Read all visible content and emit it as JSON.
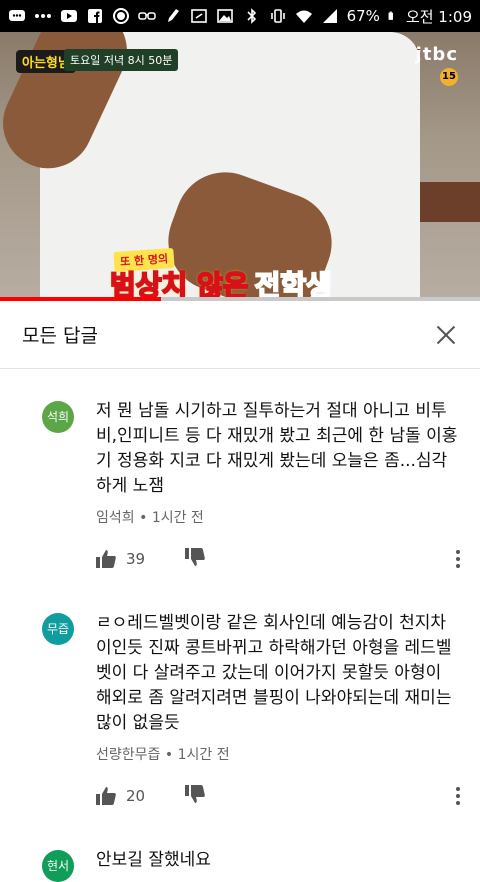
{
  "status_bar": {
    "battery": "67%",
    "time": "오전 1:09",
    "icons": [
      "chat-icon",
      "more-icon",
      "youtube-icon",
      "facebook-icon",
      "record-icon",
      "glasses-icon",
      "clean-icon",
      "screenshot-icon",
      "gallery-icon",
      "bluetooth-icon",
      "vibrate-icon",
      "wifi-icon",
      "signal-icon",
      "battery-icon"
    ]
  },
  "video": {
    "show_logo": "아는형님",
    "airtime": "토요일 저녁 8시 50분",
    "channel": "jtbc",
    "age_rating": "15",
    "caption_small": "또 한 명의",
    "caption_white": "범상치 않은",
    "caption_red": "전학생",
    "progress": 0.335
  },
  "panel": {
    "title": "모든 답글"
  },
  "comments": [
    {
      "avatar_text": "석희",
      "avatar_color": "#5ba747",
      "text": "저 뭔 남돌 시기하고 질투하는거 절대 아니고 비투비,인피니트 등 다 재밌개 봤고 최근에 한 남돌 이홍기 정용화 지코 다 재밌게 봤는데 오늘은 좀...심각하게 노잼",
      "author": "임석희",
      "time": "1시간 전",
      "likes": "39"
    },
    {
      "avatar_text": "무즙",
      "avatar_color": "#0f9d9f",
      "text": "ㄹㅇ레드벨벳이랑  같은 회사인데  예능감이 천지차이인듯 진짜 콩트바뀌고 하락해가던 아형을 레드벨벳이 다 살려주고 갔는데 이어가지 못할듯 아형이 해외로 좀 알려지려면 블핑이 나와야되는데 재미는 많이 없을듯",
      "author": "선량한무즙",
      "time": "1시간 전",
      "likes": "20"
    },
    {
      "avatar_text": "현서",
      "avatar_color": "#0f9d58",
      "text": "안보길 잘했네요",
      "author": "",
      "time": "",
      "likes": ""
    }
  ]
}
